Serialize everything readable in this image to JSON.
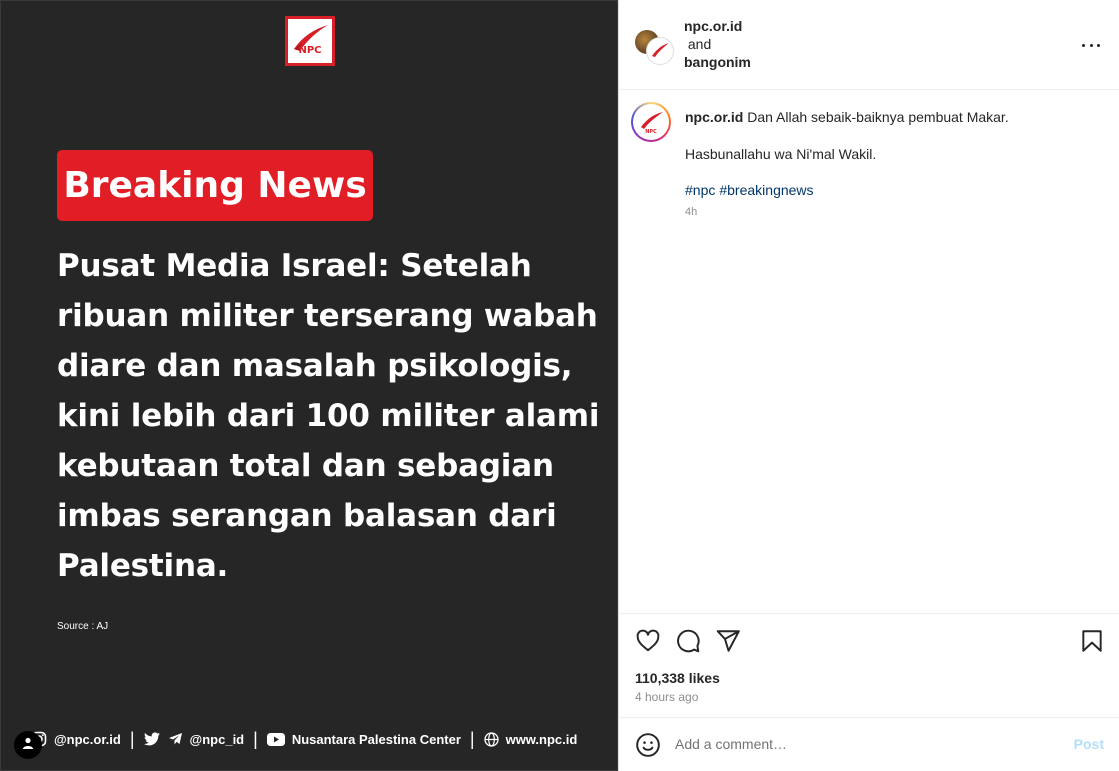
{
  "post_image": {
    "logo_text": "NPC",
    "badge": "Breaking News",
    "headline": "Pusat Media Israel: Setelah ribuan militer terserang wabah diare dan masalah psikologis, kini lebih dari 100 militer alami kebutaan total dan sebagian imbas serangan balasan dari Palestina.",
    "source": "Source : AJ",
    "footer": {
      "instagram": "@npc.or.id",
      "social": "@npc_id",
      "youtube": "Nusantara Palestina Center",
      "website": "www.npc.id",
      "separator": "|"
    }
  },
  "header": {
    "author1": "npc.or.id",
    "joiner": "and",
    "author2": "bangonim"
  },
  "caption": {
    "username": "npc.or.id",
    "line1": "Dan Allah sebaik-baiknya pembuat Makar.",
    "line2": "Hasbunallahu wa Ni'mal Wakil.",
    "hashtags": [
      "#npc",
      "#breakingnews"
    ],
    "time": "4h"
  },
  "stats": {
    "likes": "110,338 likes",
    "posted": "4 hours ago"
  },
  "comment": {
    "placeholder": "Add a comment…",
    "post_label": "Post"
  },
  "colors": {
    "badge_red": "#e11d26",
    "media_bg": "#262626",
    "hashtag": "#00376b",
    "post_disabled": "#b2dffc"
  },
  "icons": [
    "more-icon",
    "heart-icon",
    "comment-icon",
    "share-icon",
    "bookmark-icon",
    "emoji-icon",
    "instagram-icon",
    "twitter-icon",
    "telegram-icon",
    "youtube-icon",
    "globe-icon",
    "user-icon"
  ]
}
